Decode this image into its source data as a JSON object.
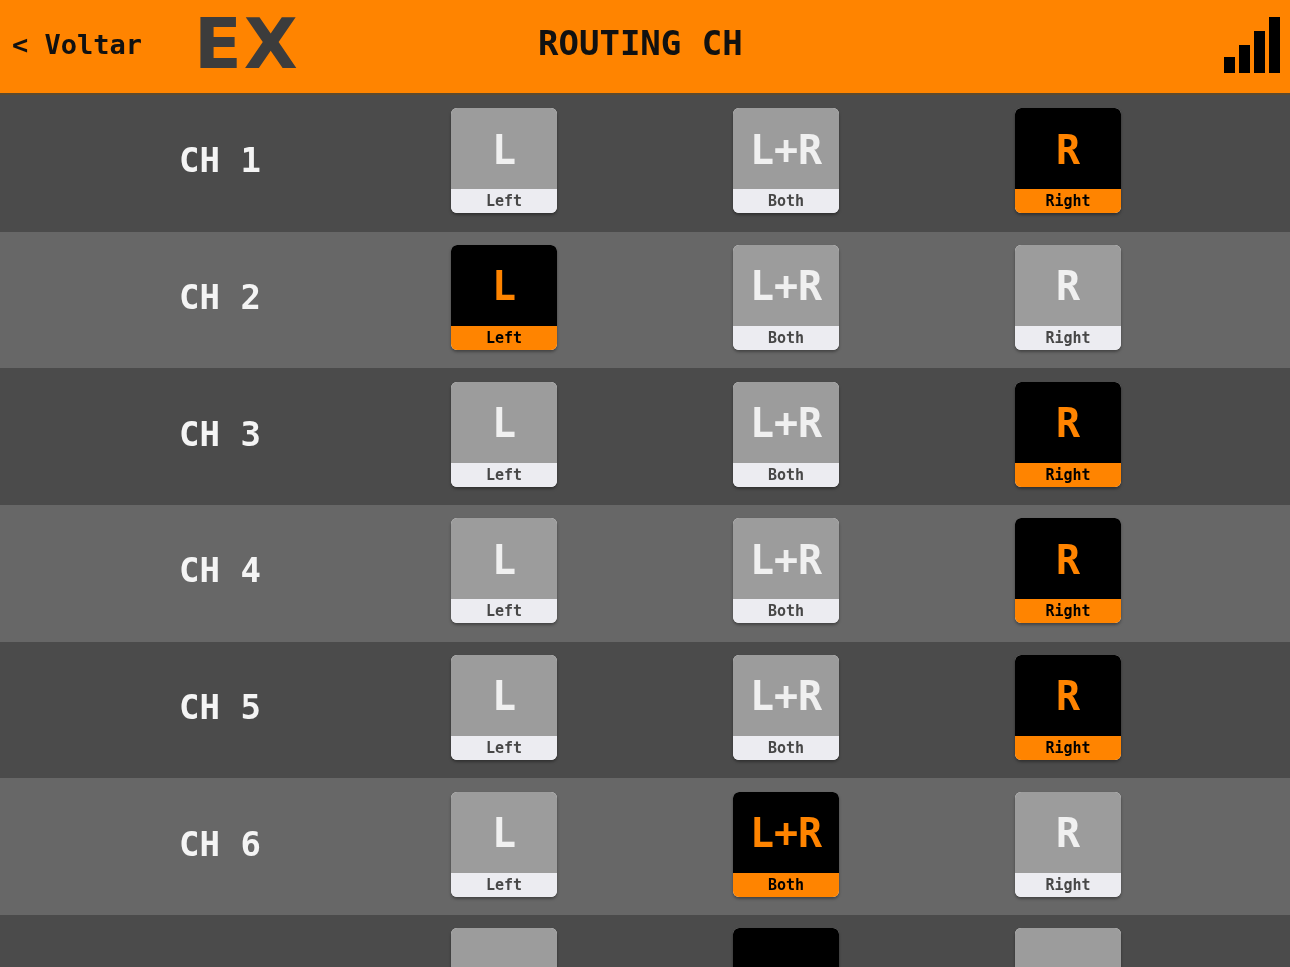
{
  "header": {
    "back_button": "< Voltar",
    "logo": "EX",
    "title": "ROUTING CH"
  },
  "channels": [
    {
      "label": "CH 1",
      "options": [
        {
          "symbol": "L",
          "caption": "Left",
          "selected": false
        },
        {
          "symbol": "L+R",
          "caption": "Both",
          "selected": false
        },
        {
          "symbol": "R",
          "caption": "Right",
          "selected": true
        }
      ]
    },
    {
      "label": "CH 2",
      "options": [
        {
          "symbol": "L",
          "caption": "Left",
          "selected": true
        },
        {
          "symbol": "L+R",
          "caption": "Both",
          "selected": false
        },
        {
          "symbol": "R",
          "caption": "Right",
          "selected": false
        }
      ]
    },
    {
      "label": "CH 3",
      "options": [
        {
          "symbol": "L",
          "caption": "Left",
          "selected": false
        },
        {
          "symbol": "L+R",
          "caption": "Both",
          "selected": false
        },
        {
          "symbol": "R",
          "caption": "Right",
          "selected": true
        }
      ]
    },
    {
      "label": "CH 4",
      "options": [
        {
          "symbol": "L",
          "caption": "Left",
          "selected": false
        },
        {
          "symbol": "L+R",
          "caption": "Both",
          "selected": false
        },
        {
          "symbol": "R",
          "caption": "Right",
          "selected": true
        }
      ]
    },
    {
      "label": "CH 5",
      "options": [
        {
          "symbol": "L",
          "caption": "Left",
          "selected": false
        },
        {
          "symbol": "L+R",
          "caption": "Both",
          "selected": false
        },
        {
          "symbol": "R",
          "caption": "Right",
          "selected": true
        }
      ]
    },
    {
      "label": "CH 6",
      "options": [
        {
          "symbol": "L",
          "caption": "Left",
          "selected": false
        },
        {
          "symbol": "L+R",
          "caption": "Both",
          "selected": true
        },
        {
          "symbol": "R",
          "caption": "Right",
          "selected": false
        }
      ]
    },
    {
      "options": [
        {
          "selected": false
        },
        {
          "selected": true
        },
        {
          "selected": false
        }
      ]
    }
  ]
}
